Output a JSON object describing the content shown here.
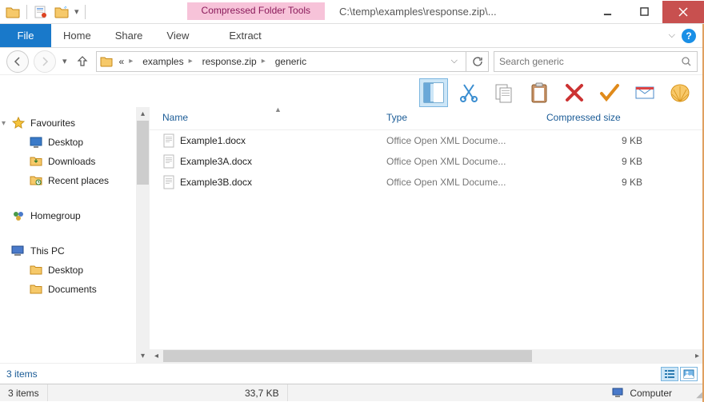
{
  "titlebar": {
    "context_tab": "Compressed Folder Tools",
    "title": "C:\\temp\\examples\\response.zip\\..."
  },
  "ribbon": {
    "file": "File",
    "tabs": [
      "Home",
      "Share",
      "View"
    ],
    "context": "Extract"
  },
  "address": {
    "crumbs": [
      "«",
      "examples",
      "response.zip",
      "generic"
    ]
  },
  "search": {
    "placeholder": "Search generic"
  },
  "columns": {
    "name": "Name",
    "type": "Type",
    "size": "Compressed size"
  },
  "sidebar": {
    "fav_label": "Favourites",
    "fav_items": [
      "Desktop",
      "Downloads",
      "Recent places"
    ],
    "homegroup": "Homegroup",
    "thispc": "This PC",
    "pc_items": [
      "Desktop",
      "Documents"
    ]
  },
  "files": [
    {
      "name": "Example1.docx",
      "type": "Office Open XML Docume...",
      "size": "9 KB"
    },
    {
      "name": "Example3A.docx",
      "type": "Office Open XML Docume...",
      "size": "9 KB"
    },
    {
      "name": "Example3B.docx",
      "type": "Office Open XML Docume...",
      "size": "9 KB"
    }
  ],
  "status": {
    "items_link": "3 items",
    "items": "3 items",
    "total_size": "33,7 KB",
    "location": "Computer"
  }
}
